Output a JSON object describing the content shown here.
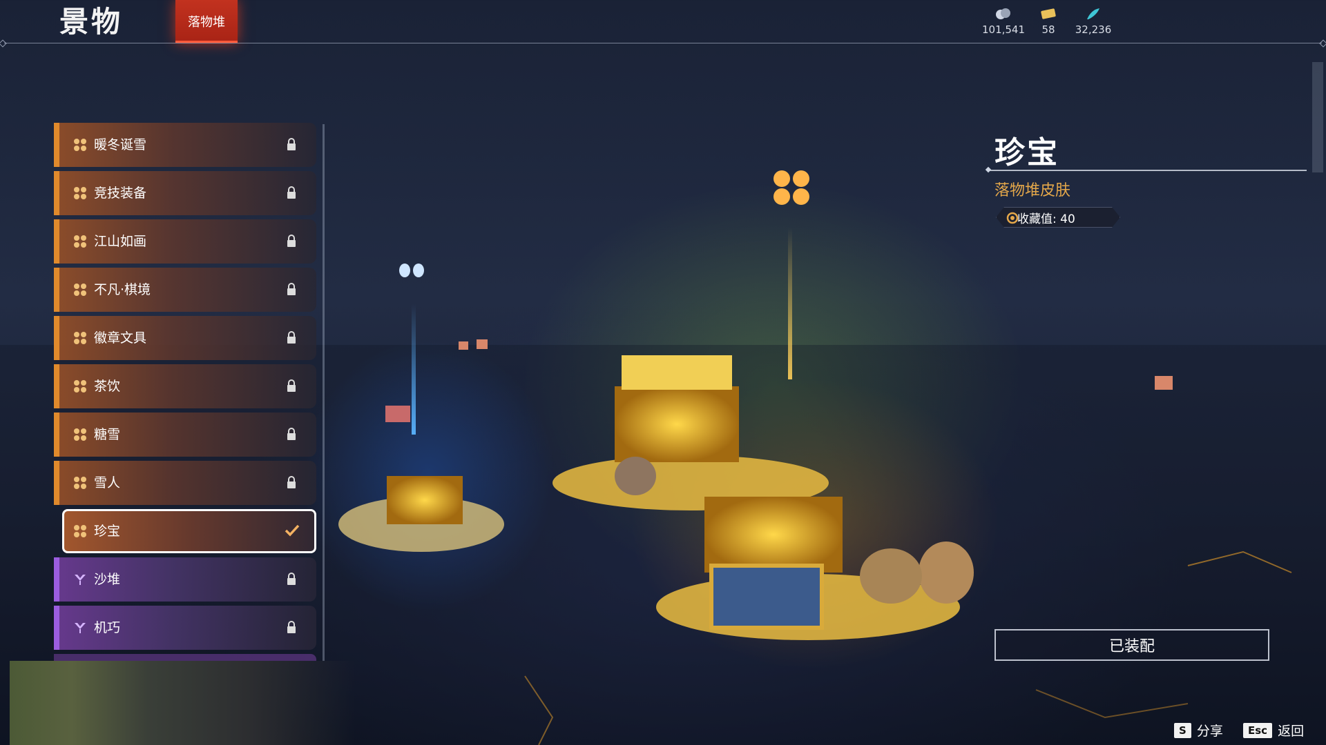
{
  "header": {
    "title": "景物",
    "tab_label": "落物堆"
  },
  "currencies": [
    {
      "icon": "coins-icon",
      "value": "101,541"
    },
    {
      "icon": "ticket-icon",
      "value": "58"
    },
    {
      "icon": "feather-icon",
      "value": "32,236"
    }
  ],
  "list": {
    "items": [
      {
        "label": "暖冬诞雪",
        "icon": "butterfly-icon",
        "color": "#e08a2c",
        "state": "locked"
      },
      {
        "label": "竞技装备",
        "icon": "butterfly-icon",
        "color": "#e08a2c",
        "state": "locked"
      },
      {
        "label": "江山如画",
        "icon": "butterfly-icon",
        "color": "#e08a2c",
        "state": "locked"
      },
      {
        "label": "不凡·棋境",
        "icon": "butterfly-icon",
        "color": "#e08a2c",
        "state": "locked"
      },
      {
        "label": "徽章文具",
        "icon": "butterfly-icon",
        "color": "#e08a2c",
        "state": "locked"
      },
      {
        "label": "茶饮",
        "icon": "butterfly-icon",
        "color": "#e08a2c",
        "state": "locked"
      },
      {
        "label": "糖雪",
        "icon": "butterfly-icon",
        "color": "#e08a2c",
        "state": "locked"
      },
      {
        "label": "雪人",
        "icon": "butterfly-icon",
        "color": "#e08a2c",
        "state": "locked"
      },
      {
        "label": "珍宝",
        "icon": "butterfly-icon",
        "color": "#e08a2c",
        "state": "equipped"
      },
      {
        "label": "沙堆",
        "icon": "wing-icon",
        "color": "#9b5de0",
        "state": "locked"
      },
      {
        "label": "机巧",
        "icon": "wing-icon",
        "color": "#9b5de0",
        "state": "locked"
      }
    ]
  },
  "detail": {
    "title": "珍宝",
    "subtitle": "落物堆皮肤",
    "collect_label": "收藏值: 40",
    "equip_button": "已装配"
  },
  "hints": [
    {
      "key": "S",
      "label": "分享"
    },
    {
      "key": "Esc",
      "label": "返回"
    }
  ],
  "colors": {
    "accent_red": "#c2321f",
    "rarity_orange": "#e08a2c",
    "rarity_purple": "#9b5de0",
    "subtitle_gold": "#e5a84a"
  }
}
